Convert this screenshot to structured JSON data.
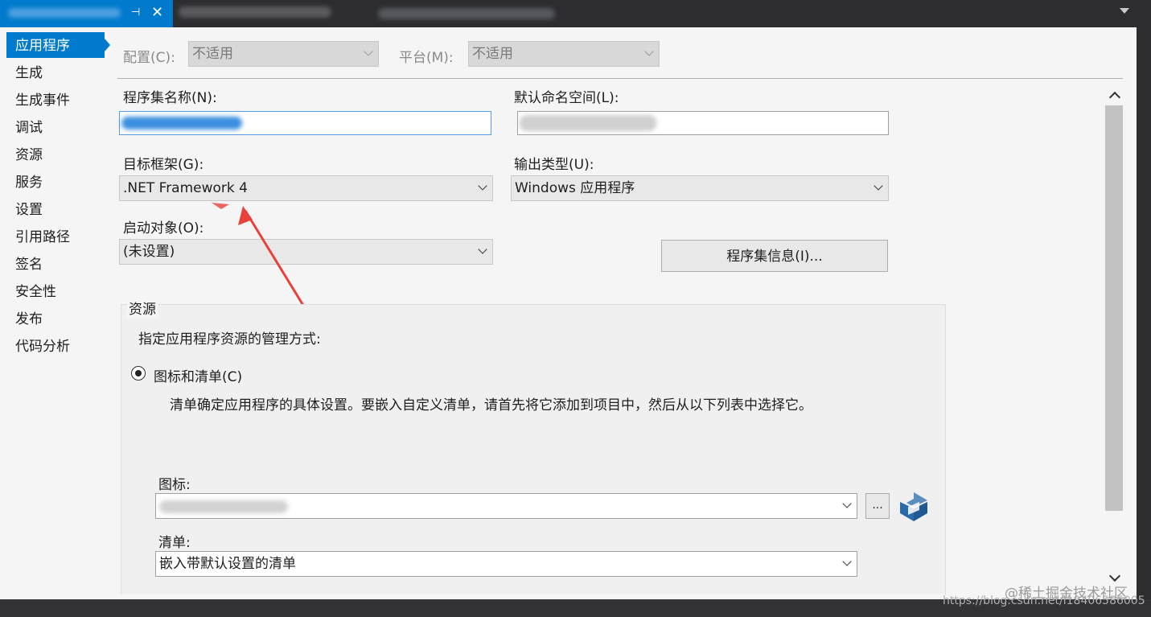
{
  "tab": {
    "pin_icon": "pin-icon",
    "close_icon": "close-icon"
  },
  "nav": {
    "items": [
      {
        "label": "应用程序",
        "selected": true
      },
      {
        "label": "生成"
      },
      {
        "label": "生成事件"
      },
      {
        "label": "调试"
      },
      {
        "label": "资源"
      },
      {
        "label": "服务"
      },
      {
        "label": "设置"
      },
      {
        "label": "引用路径"
      },
      {
        "label": "签名"
      },
      {
        "label": "安全性"
      },
      {
        "label": "发布"
      },
      {
        "label": "代码分析"
      }
    ]
  },
  "config": {
    "config_label": "配置(C):",
    "config_value": "不适用",
    "platform_label": "平台(M):",
    "platform_value": "不适用"
  },
  "form": {
    "assembly_name_label": "程序集名称(N):",
    "assembly_name_value": "",
    "default_namespace_label": "默认命名空间(L):",
    "default_namespace_value": "",
    "target_framework_label": "目标框架(G):",
    "target_framework_value": ".NET Framework 4",
    "output_type_label": "输出类型(U):",
    "output_type_value": "Windows 应用程序",
    "startup_object_label": "启动对象(O):",
    "startup_object_value": "(未设置)",
    "assembly_info_button": "程序集信息(I)..."
  },
  "resources": {
    "group_title": "资源",
    "description": "指定应用程序资源的管理方式:",
    "radio_label": "图标和清单(C)",
    "radio_selected": true,
    "radio_hint": "清单确定应用程序的具体设置。要嵌入自定义清单，请首先将它添加到项目中，然后从以下列表中选择它。",
    "icon_label": "图标:",
    "icon_value": "",
    "browse_button": "...",
    "manifest_label": "清单:",
    "manifest_value": "嵌入带默认设置的清单"
  },
  "watermark": {
    "line1": "@稀土掘金技术社区",
    "line2": "https://blog.csdn.net/l18406586005"
  },
  "colors": {
    "accent": "#007acc",
    "annotation_arrow": "#e8413c"
  }
}
